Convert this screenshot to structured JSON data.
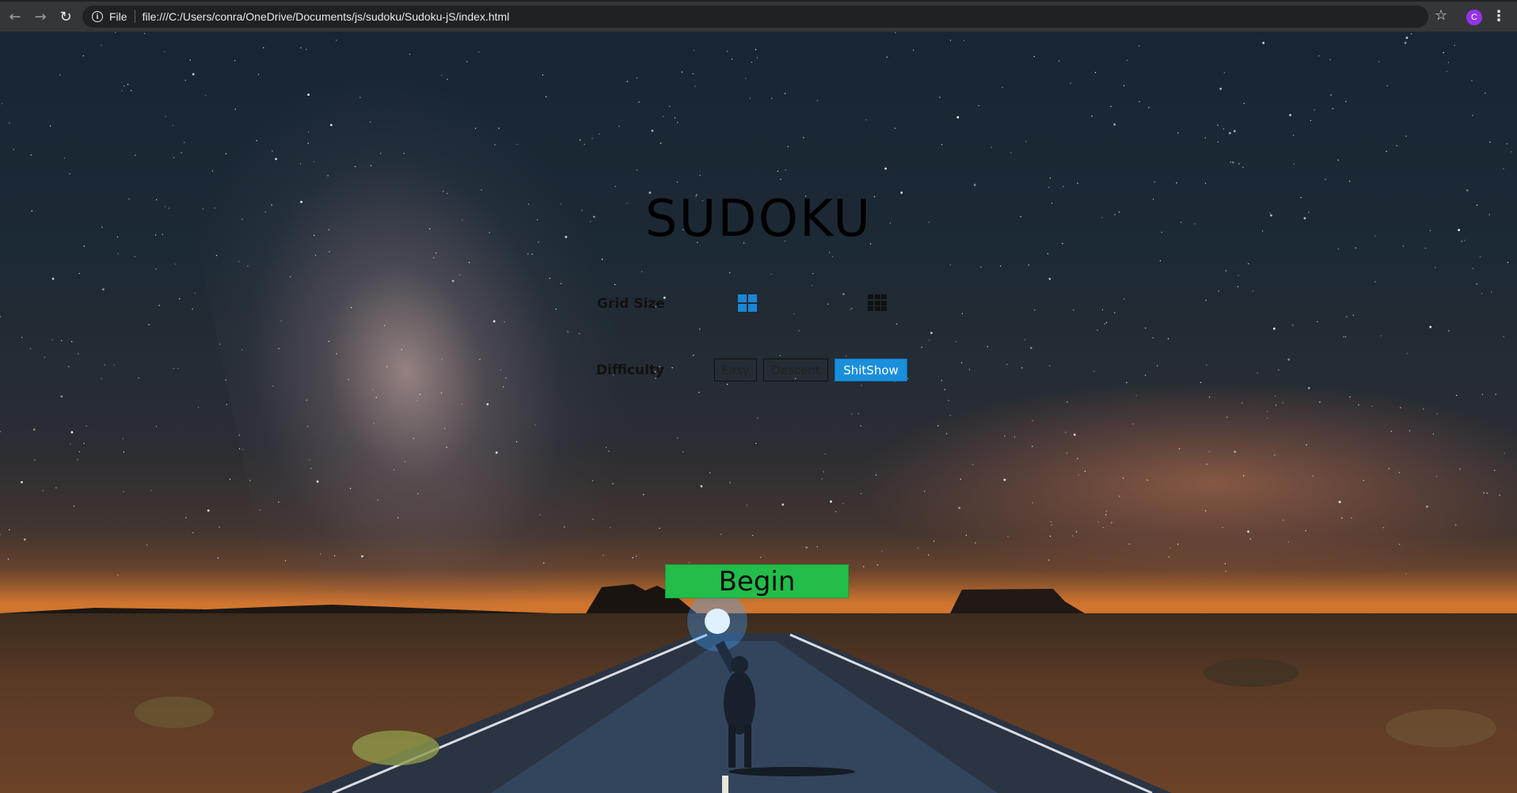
{
  "browser": {
    "back_icon": "←",
    "forward_icon": "→",
    "reload_icon": "↻",
    "info_icon": "i",
    "scheme_label": "File",
    "url": "file:///C:/Users/conra/OneDrive/Documents/js/sudoku/Sudoku-jS/index.html",
    "star_icon": "☆",
    "avatar_letter": "C",
    "menu_icon": "⋮"
  },
  "game": {
    "title": "SUDOKU",
    "grid_size_label": "Grid Size",
    "difficulty_label": "Difficulty",
    "difficulty_options": [
      "Easy",
      "Descent",
      "ShitShow"
    ],
    "selected_difficulty": "ShitShow",
    "begin_label": "Begin"
  },
  "colors": {
    "accent_blue": "#1a8fdc",
    "begin_green": "#23bd4a"
  }
}
